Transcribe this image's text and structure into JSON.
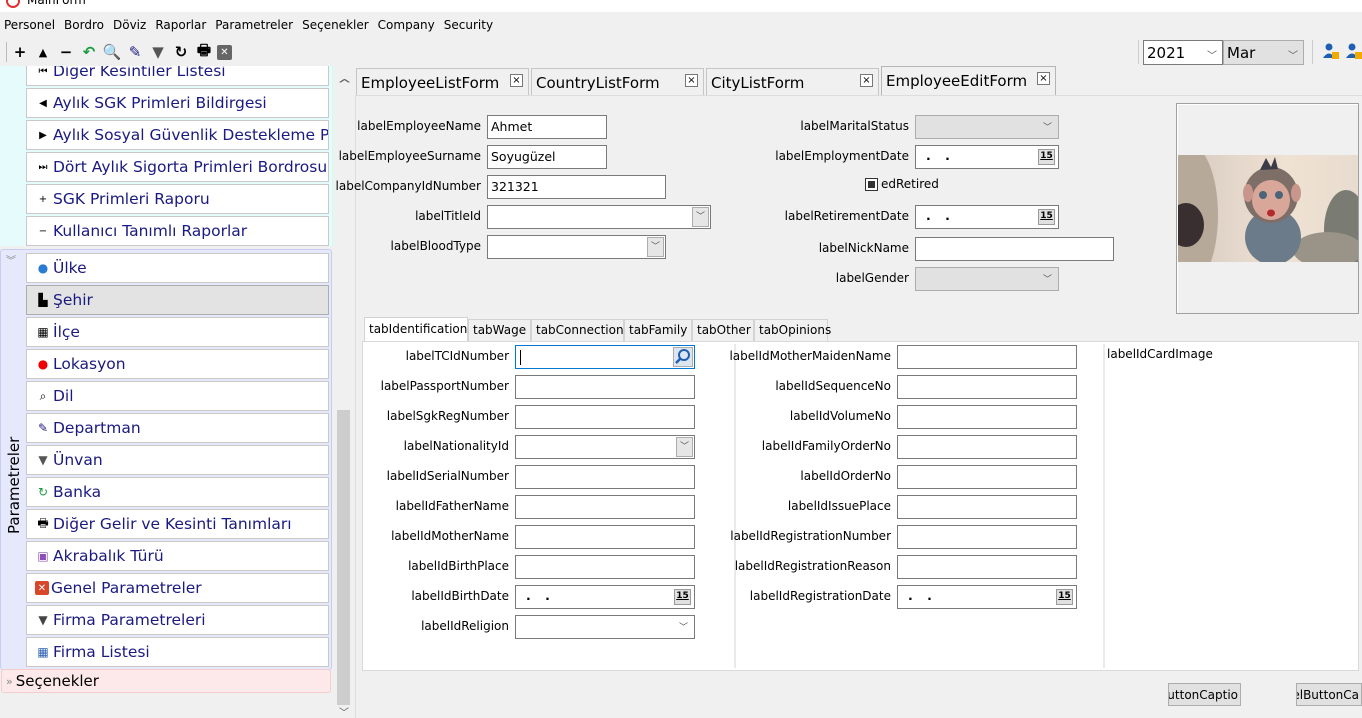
{
  "window": {
    "title": "MainForm"
  },
  "menu": [
    "Personel",
    "Bordro",
    "Döviz",
    "Raporlar",
    "Parametreler",
    "Seçenekler",
    "Company",
    "Security"
  ],
  "toolbar": {
    "buttons": [
      {
        "name": "add-icon",
        "glyph": "+"
      },
      {
        "name": "move-up-icon",
        "glyph": "▲"
      },
      {
        "name": "remove-icon",
        "glyph": "−"
      },
      {
        "name": "undo-icon",
        "glyph": "↶"
      },
      {
        "name": "search-document-icon",
        "glyph": "🔍"
      },
      {
        "name": "flashlight-icon",
        "glyph": "✎"
      },
      {
        "name": "filter-icon",
        "glyph": "▼"
      },
      {
        "name": "refresh-icon",
        "glyph": "↻"
      },
      {
        "name": "print-icon",
        "glyph": "🖶"
      },
      {
        "name": "close-icon",
        "glyph": "✕"
      }
    ],
    "year": "2021",
    "month": "Mar"
  },
  "sidebar": {
    "top_items": [
      {
        "label": "Diğer Kesintiler Listesi",
        "icon": "first-icon",
        "glyph": "⏮"
      },
      {
        "label": "Aylık SGK Primleri Bildirgesi",
        "icon": "prev-icon",
        "glyph": "◀"
      },
      {
        "label": "Aylık Sosyal Güvenlik Destekleme Pri...",
        "icon": "next-icon",
        "glyph": "▶"
      },
      {
        "label": "Dört Aylık Sigorta Primleri Bordrosu",
        "icon": "last-icon",
        "glyph": "⏭"
      },
      {
        "label": "SGK Primleri Raporu",
        "icon": "plus-icon",
        "glyph": "+"
      },
      {
        "label": "Kullanıcı Tanımlı Raporlar",
        "icon": "minus-icon",
        "glyph": "−"
      }
    ],
    "param_group_label": "Parametreler",
    "param_items": [
      {
        "label": "Ülke",
        "icon": "globe-icon",
        "glyph": "●",
        "color": "#2b7bd6"
      },
      {
        "label": "Şehir",
        "icon": "city-icon",
        "glyph": "▙",
        "color": "#000"
      },
      {
        "label": "İlçe",
        "icon": "building-icon",
        "glyph": "▦",
        "color": "#000"
      },
      {
        "label": "Lokasyon",
        "icon": "location-pin-icon",
        "glyph": "●",
        "color": "#e00"
      },
      {
        "label": "Dil",
        "icon": "search-document-icon",
        "glyph": "⌕",
        "color": "#000"
      },
      {
        "label": "Departman",
        "icon": "flashlight-icon",
        "glyph": "✎",
        "color": "#1a1a80"
      },
      {
        "label": "Ünvan",
        "icon": "filter-icon",
        "glyph": "▼",
        "color": "#555"
      },
      {
        "label": "Banka",
        "icon": "refresh-icon",
        "glyph": "↻",
        "color": "#1a9a40"
      },
      {
        "label": "Diğer Gelir ve Kesinti Tanımları",
        "icon": "print-icon",
        "glyph": "🖶",
        "color": "#000"
      },
      {
        "label": "Akrabalık Türü",
        "icon": "save-warning-icon",
        "glyph": "▣",
        "color": "#8a4fb8"
      },
      {
        "label": "Genel Parametreler",
        "icon": "close-icon",
        "glyph": "✕",
        "color": "#fff"
      },
      {
        "label": "Firma Parametreleri",
        "icon": "filter-attach-icon",
        "glyph": "▼",
        "color": "#444"
      },
      {
        "label": "Firma Listesi",
        "icon": "table-icon",
        "glyph": "▦",
        "color": "#2b5fb0"
      }
    ],
    "selected_param": "Şehir",
    "options_group_label": "Seçenekler"
  },
  "doc_tabs": [
    {
      "label": "EmployeeListForm",
      "active": false
    },
    {
      "label": "CountryListForm",
      "active": false
    },
    {
      "label": "CityListForm",
      "active": false
    },
    {
      "label": "EmployeeEditForm",
      "active": true
    }
  ],
  "form": {
    "left_fields": [
      {
        "label": "labelEmployeeName",
        "value": "Ahmet",
        "type": "text"
      },
      {
        "label": "labelEmployeeSurname",
        "value": "Soyugüzel",
        "type": "text"
      },
      {
        "label": "labelCompanyIdNumber",
        "value": "321321",
        "type": "text"
      },
      {
        "label": "labelTitleId",
        "value": "",
        "type": "combo"
      },
      {
        "label": "labelBloodType",
        "value": "",
        "type": "combo"
      }
    ],
    "right_fields": [
      {
        "label": "labelMaritalStatus",
        "value": "",
        "type": "combo-disabled"
      },
      {
        "label": "labelEmploymentDate",
        "value": ". .",
        "type": "date"
      },
      {
        "label": "labelRetirementDate",
        "value": ". .",
        "type": "date"
      },
      {
        "label": "labelNickName",
        "value": "",
        "type": "text"
      },
      {
        "label": "labelGender",
        "value": "",
        "type": "combo-disabled"
      }
    ],
    "retired_checkbox": {
      "label": "edRetired",
      "state": "indeterminate"
    }
  },
  "inner_tabs": [
    {
      "label": "tabIdentification",
      "active": true
    },
    {
      "label": "tabWage",
      "active": false
    },
    {
      "label": "tabConnection",
      "active": false
    },
    {
      "label": "tabFamily",
      "active": false
    },
    {
      "label": "tabOther",
      "active": false
    },
    {
      "label": "tabOpinions",
      "active": false
    }
  ],
  "identification": {
    "col1": [
      {
        "label": "labelTCIdNumber",
        "value": "",
        "type": "search"
      },
      {
        "label": "labelPassportNumber",
        "value": "",
        "type": "text"
      },
      {
        "label": "labelSgkRegNumber",
        "value": "",
        "type": "text"
      },
      {
        "label": "labelNationalityId",
        "value": "",
        "type": "combo"
      },
      {
        "label": "labelIdSerialNumber",
        "value": "",
        "type": "text"
      },
      {
        "label": "labelIdFatherName",
        "value": "",
        "type": "text"
      },
      {
        "label": "labelIdMotherName",
        "value": "",
        "type": "text"
      },
      {
        "label": "labelIdBirthPlace",
        "value": "",
        "type": "text"
      },
      {
        "label": "labelIdBirthDate",
        "value": ". .",
        "type": "date"
      },
      {
        "label": "labelIdReligion",
        "value": "",
        "type": "combo-plain"
      }
    ],
    "col2": [
      {
        "label": "labelIdMotherMaidenName",
        "value": "",
        "type": "text"
      },
      {
        "label": "labelIdSequenceNo",
        "value": "",
        "type": "text"
      },
      {
        "label": "labelIdVolumeNo",
        "value": "",
        "type": "text"
      },
      {
        "label": "labelIdFamilyOrderNo",
        "value": "",
        "type": "text"
      },
      {
        "label": "labelIdOrderNo",
        "value": "",
        "type": "text"
      },
      {
        "label": "labelIdIssuePlace",
        "value": "",
        "type": "text"
      },
      {
        "label": "labelIdRegistrationNumber",
        "value": "",
        "type": "text"
      },
      {
        "label": "labelIdRegistrationReason",
        "value": "",
        "type": "text"
      },
      {
        "label": "labelIdRegistrationDate",
        "value": ". .",
        "type": "date"
      }
    ],
    "card_image_label": "labelIdCardImage"
  },
  "buttons": {
    "ok": ":ButtonCaptio",
    "cancel": "celButtonCa"
  }
}
